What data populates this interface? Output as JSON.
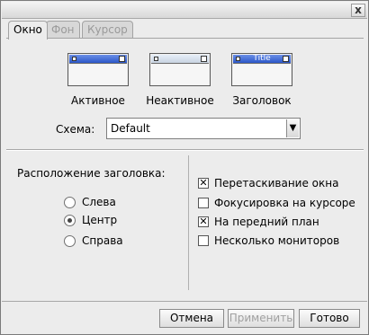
{
  "titlebar": {
    "close_glyph": "x"
  },
  "tabs": [
    {
      "label": "Окно",
      "active": true
    },
    {
      "label": "Фон",
      "active": false
    },
    {
      "label": "Курсор",
      "active": false
    }
  ],
  "previews": [
    {
      "label": "Активное",
      "state": "active",
      "title_text": ""
    },
    {
      "label": "Неактивное",
      "state": "inactive",
      "title_text": ""
    },
    {
      "label": "Заголовок",
      "state": "active",
      "title_text": "Title"
    }
  ],
  "scheme": {
    "label": "Схема:",
    "value": "Default",
    "dropdown_glyph": "▼"
  },
  "title_position": {
    "label": "Расположение заголовка:",
    "options": [
      {
        "label": "Слева",
        "selected": false
      },
      {
        "label": "Центр",
        "selected": true
      },
      {
        "label": "Справа",
        "selected": false
      }
    ]
  },
  "options": [
    {
      "label": "Перетаскивание окна",
      "checked": true
    },
    {
      "label": "Фокусировка на курсоре",
      "checked": false
    },
    {
      "label": "На передний план",
      "checked": true
    },
    {
      "label": "Несколько мониторов",
      "checked": false
    }
  ],
  "footer": {
    "cancel": "Отмена",
    "apply": "Применить",
    "ok": "Готово"
  },
  "colors": {
    "active_title": "#2b57c8",
    "inactive_title": "#c9d4e2",
    "window_bg": "#ececec"
  }
}
